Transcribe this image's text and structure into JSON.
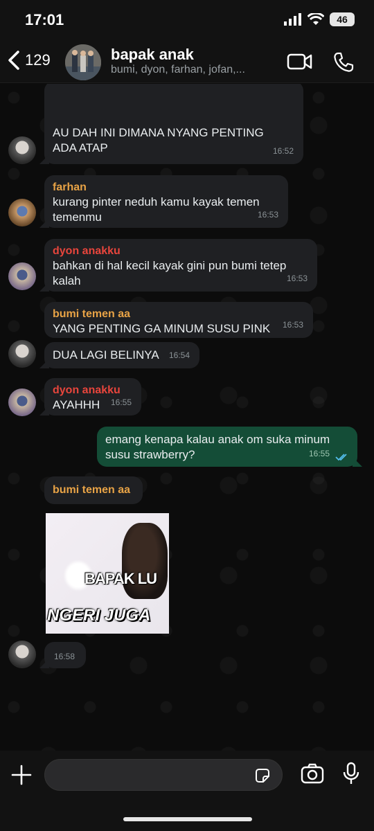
{
  "status_bar": {
    "time": "17:01",
    "battery": "46"
  },
  "header": {
    "back_count": "129",
    "title": "bapak anak",
    "members": "bumi, dyon, farhan, jofan,..."
  },
  "messages": [
    {
      "sender": "",
      "text": "AU DAH INI DIMANA NYANG PENTING ADA ATAP",
      "time": "16:52"
    },
    {
      "sender": "farhan",
      "sender_color": "#e8a346",
      "text": "kurang pinter neduh kamu kayak temen temenmu",
      "time": "16:53"
    },
    {
      "sender": "dyon anakku",
      "sender_color": "#e8453c",
      "text": "bahkan di hal kecil kayak gini pun bumi tetep kalah",
      "time": "16:53"
    },
    {
      "sender": "bumi temen aa",
      "sender_color": "#e8a346",
      "text": "YANG PENTING GA MINUM SUSU PINK",
      "time": "16:53"
    },
    {
      "sender": "",
      "text": "DUA LAGI BELINYA",
      "time": "16:54"
    },
    {
      "sender": "dyon anakku",
      "sender_color": "#e8453c",
      "text": "AYAHHH",
      "time": "16:55"
    },
    {
      "sender": "",
      "text": "emang kenapa kalau anak om suka minum susu strawberry?",
      "time": "16:55",
      "outgoing": true
    },
    {
      "sender": "bumi temen aa",
      "sender_color": "#e8a346",
      "text": "",
      "time": ""
    },
    {
      "sender": "",
      "text": "",
      "time": "16:58"
    }
  ],
  "sticker": {
    "line1": "BAPAK LU",
    "line2": "NGERI JUGA"
  },
  "colors": {
    "outgoing_bubble": "#144d37",
    "incoming_bubble": "#1f2023",
    "read_tick": "#53bdeb"
  }
}
